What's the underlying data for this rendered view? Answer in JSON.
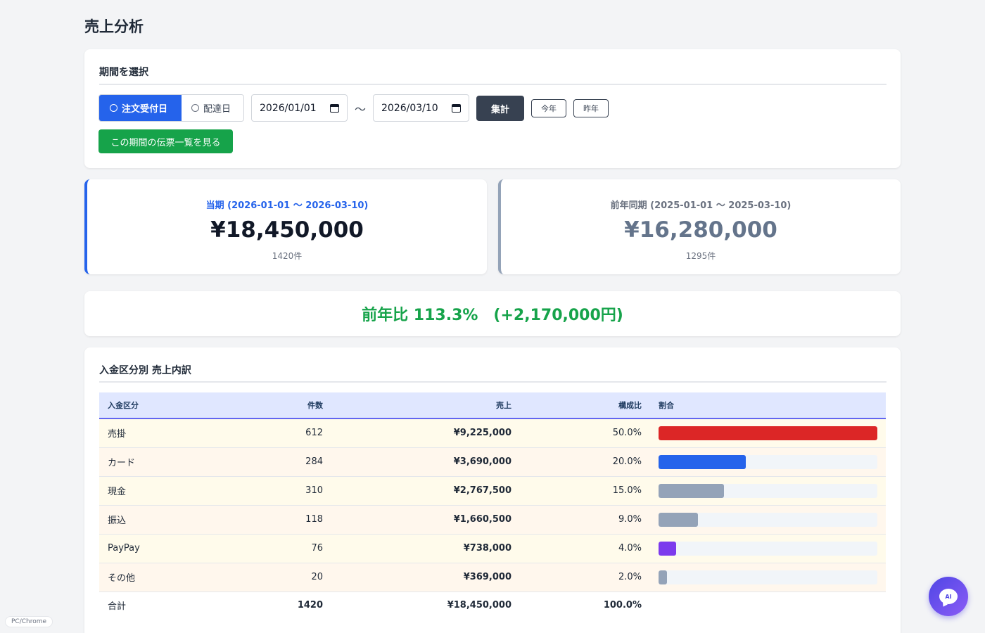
{
  "page": {
    "title": "売上分析"
  },
  "filter": {
    "title": "期間を選択",
    "mode_options": [
      {
        "label": "注文受付日",
        "selected": true
      },
      {
        "label": "配達日",
        "selected": false
      }
    ],
    "date_from": "2026/01/01",
    "date_to": "2026/03/10",
    "range_separator": "〜",
    "aggregate_label": "集計",
    "this_year_label": "今年",
    "last_year_label": "昨年",
    "view_slips_label": "この期間の伝票一覧を見る"
  },
  "summary": {
    "current": {
      "label": "当期 (2026-01-01 〜 2026-03-10)",
      "amount": "¥18,450,000",
      "count": "1420件"
    },
    "previous": {
      "label": "前年同期 (2025-01-01 〜 2025-03-10)",
      "amount": "¥16,280,000",
      "count": "1295件"
    },
    "yoy": "前年比 113.3%　(+2,170,000円)"
  },
  "breakdown": {
    "title": "入金区分別 売上内訳",
    "columns": [
      "入金区分",
      "件数",
      "売上",
      "構成比",
      "割合"
    ],
    "rows": [
      {
        "name": "売掛",
        "count": "612",
        "sales": "¥9,225,000",
        "ratio": "50.0%",
        "share": 1.0,
        "color": "#dc2626"
      },
      {
        "name": "カード",
        "count": "284",
        "sales": "¥3,690,000",
        "ratio": "20.0%",
        "share": 0.4,
        "color": "#2563eb"
      },
      {
        "name": "現金",
        "count": "310",
        "sales": "¥2,767,500",
        "ratio": "15.0%",
        "share": 0.3,
        "color": "#94a3b8"
      },
      {
        "name": "振込",
        "count": "118",
        "sales": "¥1,660,500",
        "ratio": "9.0%",
        "share": 0.18,
        "color": "#94a3b8"
      },
      {
        "name": "PayPay",
        "count": "76",
        "sales": "¥738,000",
        "ratio": "4.0%",
        "share": 0.08,
        "color": "#7c3aed"
      },
      {
        "name": "その他",
        "count": "20",
        "sales": "¥369,000",
        "ratio": "2.0%",
        "share": 0.04,
        "color": "#94a3b8"
      }
    ],
    "total": {
      "name": "合計",
      "count": "1420",
      "sales": "¥18,450,000",
      "ratio": "100.0%"
    }
  },
  "footer": {
    "env_badge": "PC/Chrome",
    "ai_label": "AI"
  }
}
